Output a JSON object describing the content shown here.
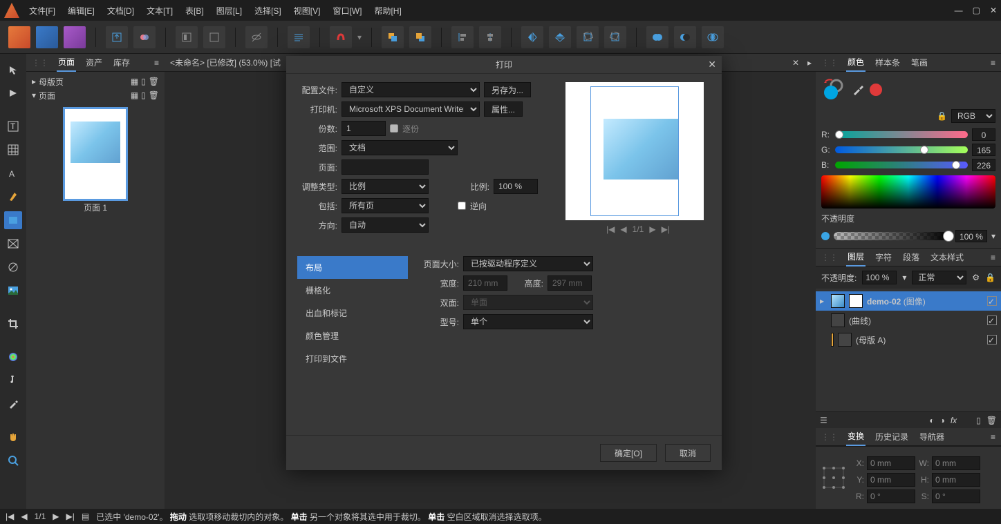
{
  "menubar": [
    "文件[F]",
    "编辑[E]",
    "文档[D]",
    "文本[T]",
    "表[B]",
    "图层[L]",
    "选择[S]",
    "视图[V]",
    "窗口[W]",
    "帮助[H]"
  ],
  "doc_tab": "<未命名> [已修改] (53.0%) [试",
  "pages_panel": {
    "tabs": [
      "页面",
      "资产",
      "库存"
    ],
    "master": "母版页",
    "pages_header": "页面",
    "page_label": "页面 1"
  },
  "right": {
    "color_tabs": [
      "颜色",
      "样本条",
      "笔画"
    ],
    "color_mode": "RGB",
    "sliders": {
      "r_label": "R:",
      "r_val": "0",
      "g_label": "G:",
      "g_val": "165",
      "b_label": "B:",
      "b_val": "226"
    },
    "opacity_label": "不透明度",
    "opacity_val": "100 %",
    "layer_tabs": [
      "图层",
      "字符",
      "段落",
      "文本样式"
    ],
    "layer_opacity_lbl": "不透明度:",
    "layer_opacity_val": "100 %",
    "blend_mode": "正常",
    "layers": [
      {
        "name": "demo-02",
        "type": "(图像)",
        "selected": true,
        "expandable": true
      },
      {
        "name": "(曲线)",
        "type": "",
        "selected": false,
        "expandable": false
      },
      {
        "name": "(母版 A)",
        "type": "",
        "selected": false,
        "expandable": false
      }
    ],
    "transform_tabs": [
      "变换",
      "历史记录",
      "导航器"
    ],
    "transform": {
      "x_lbl": "X:",
      "x": "0 mm",
      "y_lbl": "Y:",
      "y": "0 mm",
      "w_lbl": "W:",
      "w": "0 mm",
      "h_lbl": "H:",
      "h": "0 mm",
      "r_lbl": "R:",
      "r": "0 °",
      "s_lbl": "S:",
      "s": "0 °"
    }
  },
  "dialog": {
    "title": "打印",
    "profile_lbl": "配置文件:",
    "profile": "自定义",
    "save_as": "另存为...",
    "printer_lbl": "打印机:",
    "printer": "Microsoft XPS Document Writer",
    "properties": "属性...",
    "copies_lbl": "份数:",
    "copies": "1",
    "collate": "逐份",
    "range_lbl": "范围:",
    "range": "文档",
    "pages_lbl": "页面:",
    "pages": "",
    "adjust_lbl": "调整类型:",
    "adjust": "比例",
    "scale_lbl": "比例:",
    "scale": "100 %",
    "include_lbl": "包括:",
    "include": "所有页",
    "reverse": "逆向",
    "orient_lbl": "方向:",
    "orient": "自动",
    "preview_nav": "1/1",
    "lower_tabs": [
      "布局",
      "栅格化",
      "出血和标记",
      "颜色管理",
      "打印到文件"
    ],
    "page_size_lbl": "页面大小:",
    "page_size": "已按驱动程序定义",
    "width_lbl": "宽度:",
    "width": "210 mm",
    "height_lbl": "高度:",
    "height": "297 mm",
    "duplex_lbl": "双面:",
    "duplex": "单面",
    "model_lbl": "型号:",
    "model": "单个",
    "ok": "确定[O]",
    "cancel": "取消"
  },
  "status": {
    "page": "1/1",
    "sel_prefix": "已选中 ",
    "sel_name": "'demo-02'",
    "sel_dot": "。",
    "drag_lbl": "拖动",
    "drag_txt": " 选取项移动裁切内的对象。",
    "click1_lbl": "单击",
    "click1_txt": " 另一个对象将其选中用于裁切。",
    "click2_lbl": "单击",
    "click2_txt": " 空白区域取消选择选取项。"
  }
}
